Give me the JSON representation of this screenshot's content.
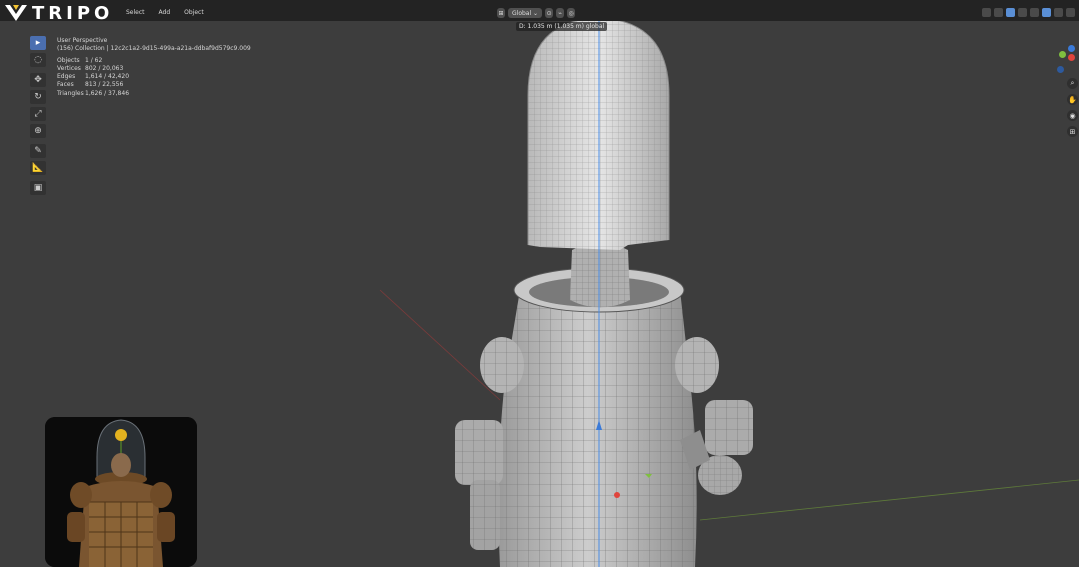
{
  "app": {
    "brand": "TRIPO"
  },
  "menu": {
    "items": [
      "Select",
      "Add",
      "Object"
    ]
  },
  "header": {
    "orientation": "Global",
    "measure_readout": "D: 1.035 m (1.035 m) global"
  },
  "viewport_info": {
    "view": "User Perspective",
    "collection": "(156) Collection | 12c2c1a2-9d15-499a-a21a-ddbaf9d579c9.009",
    "stats": [
      {
        "label": "Objects",
        "value": "1 / 62"
      },
      {
        "label": "Vertices",
        "value": "802 / 20,063"
      },
      {
        "label": "Edges",
        "value": "1,614 / 42,420"
      },
      {
        "label": "Faces",
        "value": "813 / 22,556"
      },
      {
        "label": "Triangles",
        "value": "1,626 / 37,846"
      }
    ]
  },
  "toolbar": {
    "tools": [
      "select-box",
      "cursor",
      "move",
      "rotate",
      "scale",
      "transform",
      "annotate",
      "measure",
      "add-cube"
    ]
  },
  "gizmo": {
    "x_color": "#e0443c",
    "y_color": "#7fbf3f",
    "z_color": "#3a7ad8"
  },
  "reference": {
    "caption": ""
  }
}
